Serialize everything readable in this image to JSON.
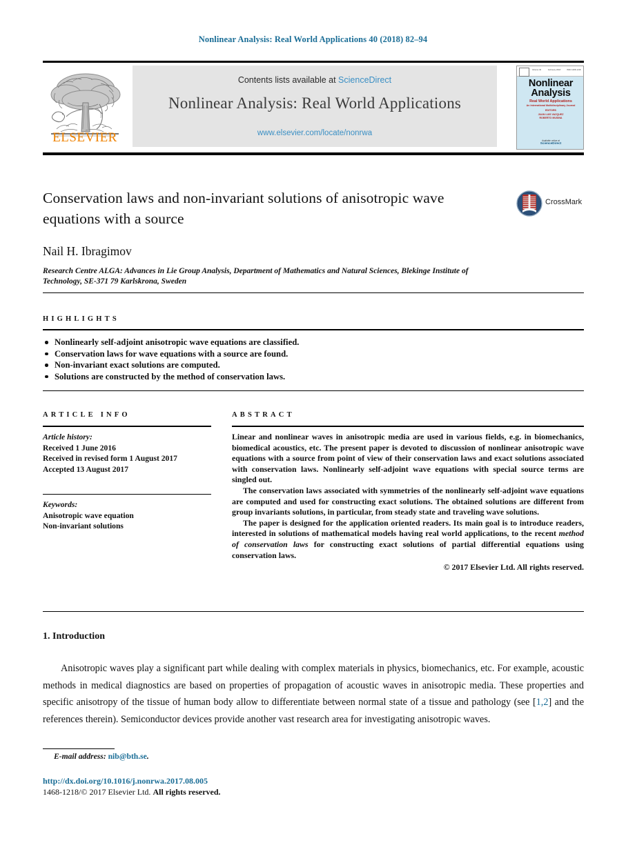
{
  "running_head": "Nonlinear Analysis: Real World Applications 40 (2018) 82–94",
  "masthead": {
    "publisher_name": "ELSEVIER",
    "publisher_logo_icon": "elsevier-tree-logo",
    "contents_prefix": "Contents lists available at ",
    "contents_link": "ScienceDirect",
    "journal_name": "Nonlinear Analysis: Real World Applications",
    "journal_url": "www.elsevier.com/locate/nonrwa",
    "cover": {
      "title_line1": "Nonlinear",
      "title_line2": "Analysis",
      "subtitle_line1": "Real World Applications",
      "subtitle_line2": "An International Multidisciplinary Journal",
      "editors_line1": "EDITORS",
      "editors_line2": "JUAN LUIS VAZQUEZ",
      "editors_line3": "ROBERTO MUSINA",
      "topbar_left": "Volume 40",
      "topbar_mid": "February 2018",
      "topbar_right": "ISSN 1468-1218",
      "footer_line1": "Available online at",
      "footer_link": "ScienceDirect"
    }
  },
  "article": {
    "title": "Conservation laws and non-invariant solutions of anisotropic wave equations with a source",
    "crossmark_label": "CrossMark",
    "crossmark_icon": "crossmark-badge-icon",
    "author": "Nail H. Ibragimov",
    "affiliation": "Research Centre ALGA: Advances in Lie Group Analysis, Department of Mathematics and Natural Sciences, Blekinge Institute of Technology, SE-371 79 Karlskrona, Sweden"
  },
  "highlights": {
    "label": "HIGHLIGHTS",
    "items": [
      "Nonlinearly self-adjoint anisotropic wave equations are classified.",
      "Conservation laws for wave equations with a source are found.",
      "Non-invariant exact solutions are computed.",
      "Solutions are constructed by the method of conservation laws."
    ]
  },
  "article_info": {
    "label": "ARTICLE INFO",
    "history_heading": "Article history:",
    "history_lines": [
      "Received 1 June 2016",
      "Received in revised form 1 August 2017",
      "Accepted 13 August 2017"
    ],
    "keywords_heading": "Keywords:",
    "keywords": [
      "Anisotropic wave equation",
      "Non-invariant solutions"
    ]
  },
  "abstract": {
    "label": "ABSTRACT",
    "para1": "Linear and nonlinear waves in anisotropic media are used in various fields, e.g. in biomechanics, biomedical acoustics, etc. The present paper is devoted to discussion of nonlinear anisotropic wave equations with a source from point of view of their conservation laws and exact solutions associated with conservation laws. Nonlinearly self-adjoint wave equations with special source terms are singled out.",
    "para2": "The conservation laws associated with symmetries of the nonlinearly self-adjoint wave equations are computed and used for constructing exact solutions. The obtained solutions are different from group invariants solutions, in particular, from steady state and traveling wave solutions.",
    "para3_before": "The paper is designed for the application oriented readers. Its main goal is to introduce readers, interested in solutions of mathematical models having real world applications, to the recent ",
    "para3_italic": "method of conservation laws",
    "para3_after": " for constructing exact solutions of partial differential equations using conservation laws.",
    "copyright": "© 2017 Elsevier Ltd. All rights reserved."
  },
  "introduction": {
    "heading": "1. Introduction",
    "para_before_cite": "Anisotropic waves play a significant part while dealing with complex materials in physics, biomechanics, etc. For example, acoustic methods in medical diagnostics are based on properties of propagation of acoustic waves in anisotropic media. These properties and specific anisotropy of the tissue of human body allow to differentiate between normal state of a tissue and pathology (see [",
    "citation": "1,2",
    "para_after_cite": "] and the references therein). Semiconductor devices provide another vast research area for investigating anisotropic waves."
  },
  "footer": {
    "email_label": "E-mail address:",
    "email": "nib@bth.se",
    "email_period": ".",
    "doi": "http://dx.doi.org/10.1016/j.nonrwa.2017.08.005",
    "issn_prefix": "1468-1218/© 2017 Elsevier Ltd. ",
    "issn_bold": "All rights reserved."
  },
  "colors": {
    "link_blue": "#1a6d96",
    "banner_gray": "#e4e4e4",
    "elsevier_orange": "#ef8200",
    "sciencedirect_blue": "#3a8fc4",
    "cover_blue": "#cfe7f2",
    "crossmark_red": "#b5312a"
  }
}
